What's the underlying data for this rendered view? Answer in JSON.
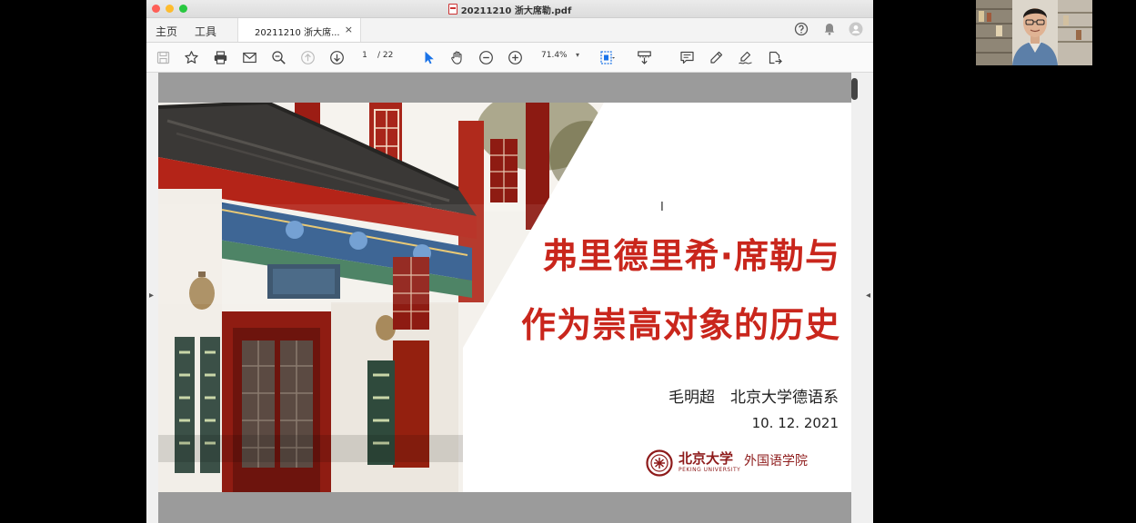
{
  "window": {
    "title": "20211210 浙大席勒.pdf"
  },
  "tabbar": {
    "home_label": "主页",
    "tools_label": "工具",
    "doc_tab_label": "20211210 浙大席...",
    "doc_tab_close": "×"
  },
  "toolbar": {
    "page_current": "1",
    "page_total": "/ 22",
    "zoom": "71.4%",
    "zoom_caret": "▾"
  },
  "slide": {
    "title_line1": "弗里德里希·席勒与",
    "title_line2": "作为崇高对象的历史",
    "author": "毛明超　北京大学德语系",
    "date": "10. 12. 2021",
    "logo_cn": "北京大学",
    "logo_en": "PEKING UNIVERSITY",
    "logo_school": "外国语学院"
  },
  "colors": {
    "title_red": "#c9261c",
    "logo_red": "#8e1b1b",
    "accent_blue": "#1a73e8"
  },
  "icons": [
    "save-icon",
    "star-icon",
    "print-icon",
    "mail-icon",
    "zoom-search-icon",
    "page-up-icon",
    "page-down-icon",
    "select-cursor-icon",
    "hand-icon",
    "zoom-out-icon",
    "zoom-in-icon",
    "fit-page-icon",
    "scroll-mode-icon",
    "comment-icon",
    "pen-icon",
    "sign-icon",
    "share-icon",
    "help-icon",
    "bell-icon",
    "account-icon"
  ]
}
